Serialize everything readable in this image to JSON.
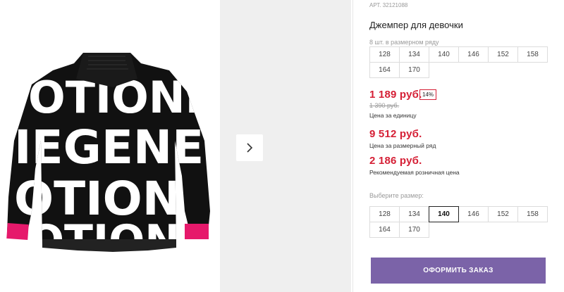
{
  "product": {
    "article": "АРТ. 32121088",
    "title": "Джемпер для девочки",
    "image_alt": "sweater-image"
  },
  "pack": {
    "label": "8 шт. в размерном ряду",
    "sizes": [
      "128",
      "134",
      "140",
      "146",
      "152",
      "158",
      "164",
      "170"
    ]
  },
  "prices": {
    "unit_price": "1 189 руб.",
    "discount": "14%",
    "old_price": "1 390 руб.",
    "unit_caption": "Цена за единицу",
    "pack_price": "9 512 руб.",
    "pack_caption": "Цена за размерный ряд",
    "retail_price": "2 186 руб.",
    "retail_caption": "Рекомендуемая розничная цена"
  },
  "size_select": {
    "label": "Выберите размер:",
    "sizes": [
      "128",
      "134",
      "140",
      "146",
      "152",
      "158",
      "164",
      "170"
    ],
    "selected": "140"
  },
  "order": {
    "label": "ОФОРМИТЬ ЗАКАЗ"
  },
  "colors": {
    "accent": "#7b63a8",
    "price": "#d51f35",
    "thumb_bg": "#efefef"
  }
}
